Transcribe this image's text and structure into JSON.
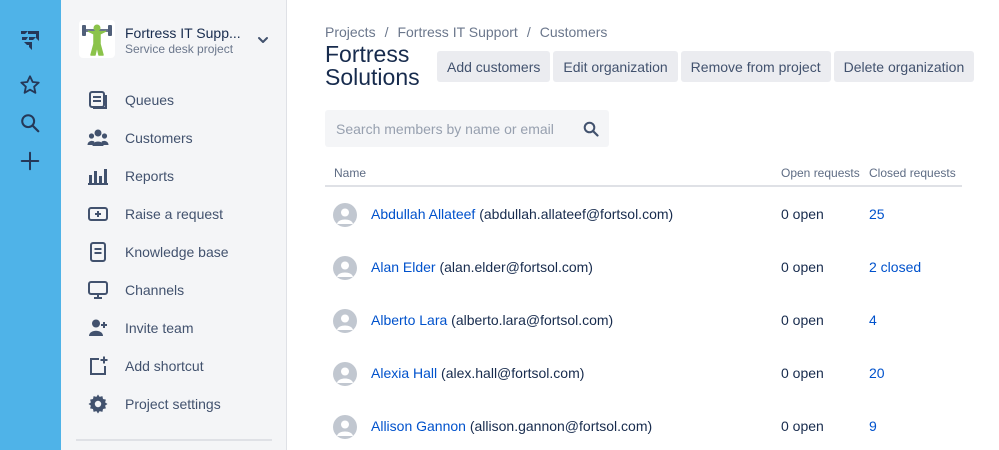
{
  "global_nav": {
    "icons": [
      "jira-logo-icon",
      "star-icon",
      "search-icon",
      "plus-icon"
    ]
  },
  "project": {
    "name": "Fortress IT Supp...",
    "type": "Service desk project"
  },
  "sidebar": {
    "items": [
      {
        "label": "Queues",
        "icon": "queues-icon"
      },
      {
        "label": "Customers",
        "icon": "customers-icon"
      },
      {
        "label": "Reports",
        "icon": "reports-icon"
      },
      {
        "label": "Raise a request",
        "icon": "raise-request-icon"
      },
      {
        "label": "Knowledge base",
        "icon": "knowledge-base-icon"
      },
      {
        "label": "Channels",
        "icon": "channels-icon"
      },
      {
        "label": "Invite team",
        "icon": "invite-team-icon"
      },
      {
        "label": "Add shortcut",
        "icon": "add-shortcut-icon"
      },
      {
        "label": "Project settings",
        "icon": "gear-icon"
      }
    ]
  },
  "breadcrumb": {
    "items": [
      "Projects",
      "Fortress IT Support",
      "Customers"
    ],
    "separator": "/"
  },
  "page": {
    "title": "Fortress Solutions"
  },
  "actions": {
    "add_customers": "Add customers",
    "edit_organization": "Edit organization",
    "remove_from_project": "Remove from project",
    "delete_organization": "Delete organization"
  },
  "search": {
    "placeholder": "Search members by name or email",
    "value": ""
  },
  "table": {
    "headers": {
      "name": "Name",
      "open": "Open requests",
      "closed": "Closed requests"
    },
    "rows": [
      {
        "name": "Abdullah Allateef",
        "email": "(abdullah.allateef@fortsol.com)",
        "open": "0 open",
        "closed": "25"
      },
      {
        "name": "Alan Elder",
        "email": "(alan.elder@fortsol.com)",
        "open": "0 open",
        "closed": "2 closed"
      },
      {
        "name": "Alberto Lara",
        "email": "(alberto.lara@fortsol.com)",
        "open": "0 open",
        "closed": "4"
      },
      {
        "name": "Alexia Hall",
        "email": "(alex.hall@fortsol.com)",
        "open": "0 open",
        "closed": "20"
      },
      {
        "name": "Allison Gannon",
        "email": "(allison.gannon@fortsol.com)",
        "open": "0 open",
        "closed": "9"
      }
    ]
  },
  "colors": {
    "global_nav": "#4FB3E8",
    "sidebar_bg": "#F4F5F7",
    "link": "#0052CC",
    "text": "#172B4D",
    "button_bg": "#EBECF0"
  }
}
